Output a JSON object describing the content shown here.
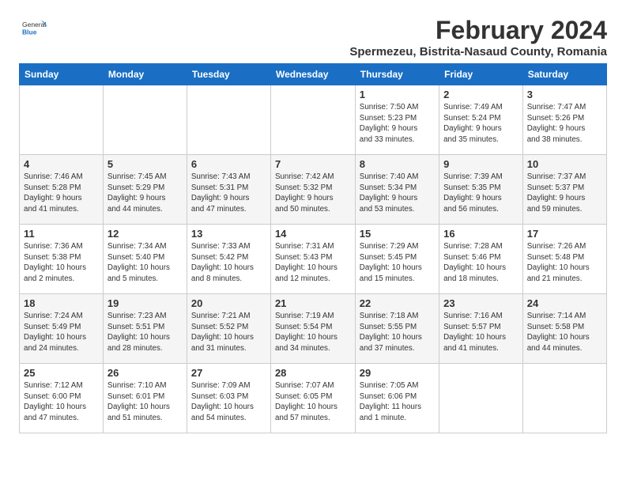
{
  "header": {
    "logo_general": "General",
    "logo_blue": "Blue",
    "main_title": "February 2024",
    "subtitle": "Spermezeu, Bistrita-Nasaud County, Romania"
  },
  "weekdays": [
    "Sunday",
    "Monday",
    "Tuesday",
    "Wednesday",
    "Thursday",
    "Friday",
    "Saturday"
  ],
  "rows": [
    [
      {
        "day": "",
        "info": ""
      },
      {
        "day": "",
        "info": ""
      },
      {
        "day": "",
        "info": ""
      },
      {
        "day": "",
        "info": ""
      },
      {
        "day": "1",
        "info": "Sunrise: 7:50 AM\nSunset: 5:23 PM\nDaylight: 9 hours\nand 33 minutes."
      },
      {
        "day": "2",
        "info": "Sunrise: 7:49 AM\nSunset: 5:24 PM\nDaylight: 9 hours\nand 35 minutes."
      },
      {
        "day": "3",
        "info": "Sunrise: 7:47 AM\nSunset: 5:26 PM\nDaylight: 9 hours\nand 38 minutes."
      }
    ],
    [
      {
        "day": "4",
        "info": "Sunrise: 7:46 AM\nSunset: 5:28 PM\nDaylight: 9 hours\nand 41 minutes."
      },
      {
        "day": "5",
        "info": "Sunrise: 7:45 AM\nSunset: 5:29 PM\nDaylight: 9 hours\nand 44 minutes."
      },
      {
        "day": "6",
        "info": "Sunrise: 7:43 AM\nSunset: 5:31 PM\nDaylight: 9 hours\nand 47 minutes."
      },
      {
        "day": "7",
        "info": "Sunrise: 7:42 AM\nSunset: 5:32 PM\nDaylight: 9 hours\nand 50 minutes."
      },
      {
        "day": "8",
        "info": "Sunrise: 7:40 AM\nSunset: 5:34 PM\nDaylight: 9 hours\nand 53 minutes."
      },
      {
        "day": "9",
        "info": "Sunrise: 7:39 AM\nSunset: 5:35 PM\nDaylight: 9 hours\nand 56 minutes."
      },
      {
        "day": "10",
        "info": "Sunrise: 7:37 AM\nSunset: 5:37 PM\nDaylight: 9 hours\nand 59 minutes."
      }
    ],
    [
      {
        "day": "11",
        "info": "Sunrise: 7:36 AM\nSunset: 5:38 PM\nDaylight: 10 hours\nand 2 minutes."
      },
      {
        "day": "12",
        "info": "Sunrise: 7:34 AM\nSunset: 5:40 PM\nDaylight: 10 hours\nand 5 minutes."
      },
      {
        "day": "13",
        "info": "Sunrise: 7:33 AM\nSunset: 5:42 PM\nDaylight: 10 hours\nand 8 minutes."
      },
      {
        "day": "14",
        "info": "Sunrise: 7:31 AM\nSunset: 5:43 PM\nDaylight: 10 hours\nand 12 minutes."
      },
      {
        "day": "15",
        "info": "Sunrise: 7:29 AM\nSunset: 5:45 PM\nDaylight: 10 hours\nand 15 minutes."
      },
      {
        "day": "16",
        "info": "Sunrise: 7:28 AM\nSunset: 5:46 PM\nDaylight: 10 hours\nand 18 minutes."
      },
      {
        "day": "17",
        "info": "Sunrise: 7:26 AM\nSunset: 5:48 PM\nDaylight: 10 hours\nand 21 minutes."
      }
    ],
    [
      {
        "day": "18",
        "info": "Sunrise: 7:24 AM\nSunset: 5:49 PM\nDaylight: 10 hours\nand 24 minutes."
      },
      {
        "day": "19",
        "info": "Sunrise: 7:23 AM\nSunset: 5:51 PM\nDaylight: 10 hours\nand 28 minutes."
      },
      {
        "day": "20",
        "info": "Sunrise: 7:21 AM\nSunset: 5:52 PM\nDaylight: 10 hours\nand 31 minutes."
      },
      {
        "day": "21",
        "info": "Sunrise: 7:19 AM\nSunset: 5:54 PM\nDaylight: 10 hours\nand 34 minutes."
      },
      {
        "day": "22",
        "info": "Sunrise: 7:18 AM\nSunset: 5:55 PM\nDaylight: 10 hours\nand 37 minutes."
      },
      {
        "day": "23",
        "info": "Sunrise: 7:16 AM\nSunset: 5:57 PM\nDaylight: 10 hours\nand 41 minutes."
      },
      {
        "day": "24",
        "info": "Sunrise: 7:14 AM\nSunset: 5:58 PM\nDaylight: 10 hours\nand 44 minutes."
      }
    ],
    [
      {
        "day": "25",
        "info": "Sunrise: 7:12 AM\nSunset: 6:00 PM\nDaylight: 10 hours\nand 47 minutes."
      },
      {
        "day": "26",
        "info": "Sunrise: 7:10 AM\nSunset: 6:01 PM\nDaylight: 10 hours\nand 51 minutes."
      },
      {
        "day": "27",
        "info": "Sunrise: 7:09 AM\nSunset: 6:03 PM\nDaylight: 10 hours\nand 54 minutes."
      },
      {
        "day": "28",
        "info": "Sunrise: 7:07 AM\nSunset: 6:05 PM\nDaylight: 10 hours\nand 57 minutes."
      },
      {
        "day": "29",
        "info": "Sunrise: 7:05 AM\nSunset: 6:06 PM\nDaylight: 11 hours\nand 1 minute."
      },
      {
        "day": "",
        "info": ""
      },
      {
        "day": "",
        "info": ""
      }
    ]
  ]
}
